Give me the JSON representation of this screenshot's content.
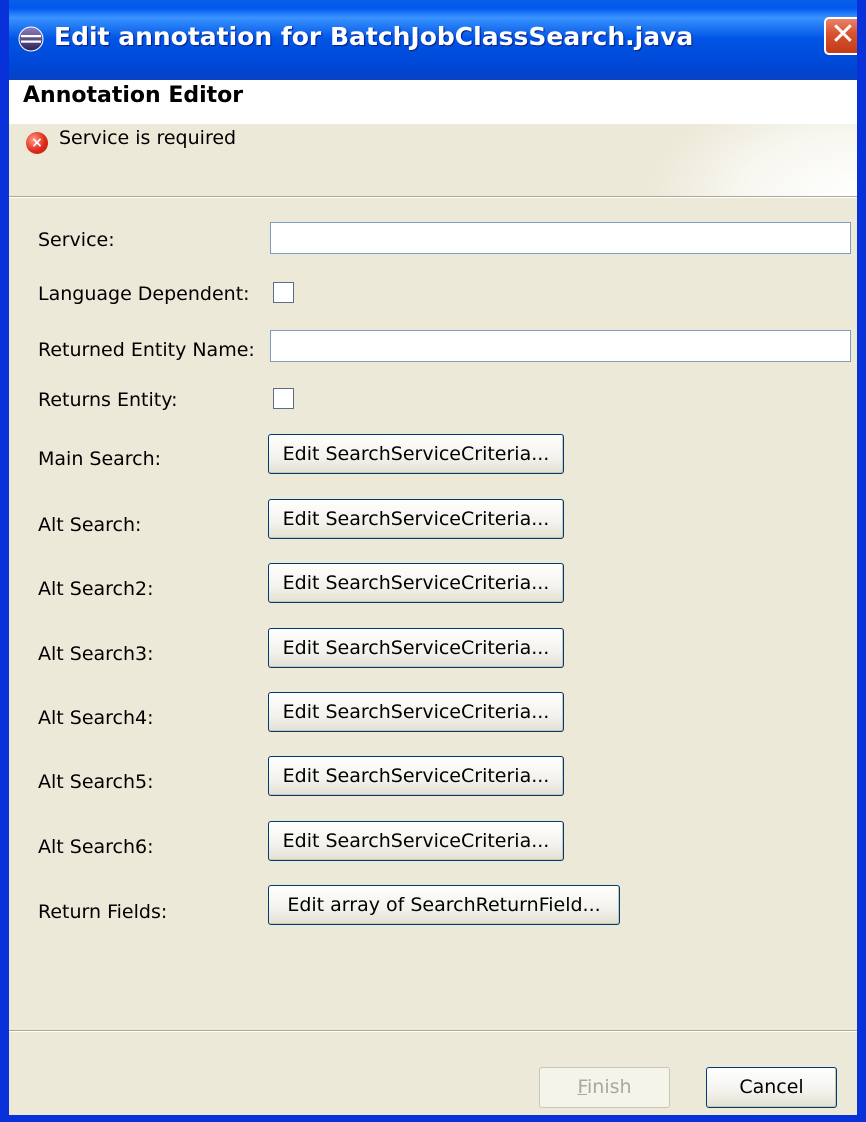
{
  "window": {
    "title": "Edit annotation for BatchJobClassSearch.java",
    "close_label": "✕"
  },
  "header": {
    "title": "Annotation Editor",
    "error_message": "Service is required"
  },
  "form": {
    "service": {
      "label": "Service:",
      "value": ""
    },
    "language_dependent": {
      "label": "Language Dependent:",
      "checked": false
    },
    "returned_entity_name": {
      "label": "Returned Entity Name:",
      "value": ""
    },
    "returns_entity": {
      "label": "Returns Entity:",
      "checked": false
    },
    "searches": [
      {
        "label": "Main Search:",
        "button": "Edit SearchServiceCriteria..."
      },
      {
        "label": "Alt Search:",
        "button": "Edit SearchServiceCriteria..."
      },
      {
        "label": "Alt Search2:",
        "button": "Edit SearchServiceCriteria..."
      },
      {
        "label": "Alt Search3:",
        "button": "Edit SearchServiceCriteria..."
      },
      {
        "label": "Alt Search4:",
        "button": "Edit SearchServiceCriteria..."
      },
      {
        "label": "Alt Search5:",
        "button": "Edit SearchServiceCriteria..."
      },
      {
        "label": "Alt Search6:",
        "button": "Edit SearchServiceCriteria..."
      }
    ],
    "return_fields": {
      "label": "Return Fields:",
      "button": "Edit array of SearchReturnField..."
    }
  },
  "footer": {
    "finish_mnemonic": "F",
    "finish_rest": "inish",
    "finish_enabled": false,
    "cancel_label": "Cancel"
  },
  "colors": {
    "dialog_bg": "#ece9d8",
    "titlebar_blue": "#0058ee",
    "frame_blue": "#0831d9",
    "error_red": "#e02b1a"
  }
}
